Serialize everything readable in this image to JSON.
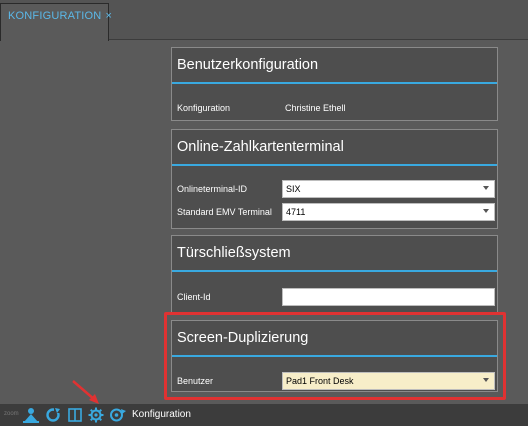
{
  "tab": {
    "title": "KONFIGURATION",
    "close": "×"
  },
  "sections": {
    "user": {
      "title": "Benutzerkonfiguration",
      "label": "Konfiguration",
      "value": "Christine Ethell"
    },
    "terminal": {
      "title": "Online-Zahlkartenterminal",
      "rows": [
        {
          "label": "Onlineterminal-ID",
          "value": "SIX"
        },
        {
          "label": "Standard EMV Terminal",
          "value": "4711"
        }
      ]
    },
    "lock": {
      "title": "Türschließsystem",
      "label": "Client-Id",
      "value": ""
    },
    "screen": {
      "title": "Screen-Duplizierung",
      "label": "Benutzer",
      "value": "Pad1 Front Desk"
    }
  },
  "statusbar": {
    "dim_text": "zoom",
    "label": "Konfiguration",
    "icons": [
      "person-icon",
      "refresh-icon",
      "book-icon",
      "gear-icon",
      "sync-icon"
    ]
  },
  "colors": {
    "accent": "#39a9e0",
    "highlight": "#e03232",
    "tab_text": "#5bb8e8"
  }
}
